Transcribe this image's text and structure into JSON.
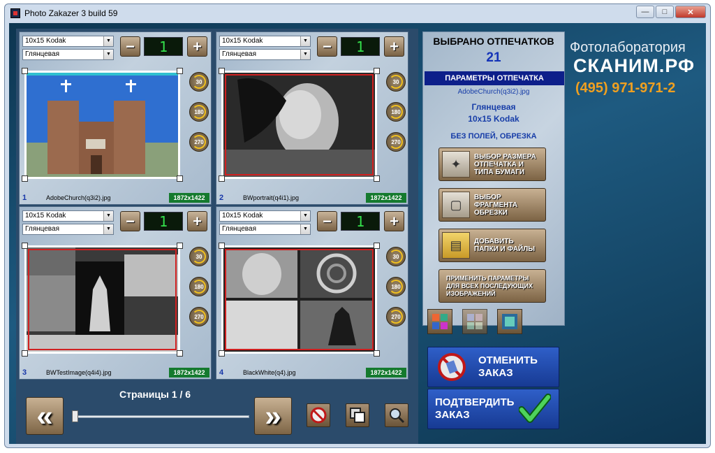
{
  "window": {
    "title": "Photo Zakazer 3 build 59",
    "controls": {
      "minimize": "—",
      "maximize": "□",
      "close": "✕"
    }
  },
  "cells": [
    {
      "index": "1",
      "size": "10x15 Kodak",
      "paper": "Глянцевая",
      "qty": "1",
      "file": "AdobeChurch(q3i2).jpg",
      "resolution": "1872x1422"
    },
    {
      "index": "2",
      "size": "10x15 Kodak",
      "paper": "Глянцевая",
      "qty": "1",
      "file": "BWportrait(q4i1).jpg",
      "resolution": "1872x1422"
    },
    {
      "index": "3",
      "size": "10x15 Kodak",
      "paper": "Глянцевая",
      "qty": "1",
      "file": "BWTestImage(q4i4).jpg",
      "resolution": "1872x1422"
    },
    {
      "index": "4",
      "size": "10x15 Kodak",
      "paper": "Глянцевая",
      "qty": "1",
      "file": "BlackWhite(q4).jpg",
      "resolution": "1872x1422"
    }
  ],
  "rotate": {
    "r30": "30",
    "r180": "180",
    "r270": "270"
  },
  "pager": {
    "label": "Страницы 1 / 6",
    "prev": "«",
    "next": "»"
  },
  "panel": {
    "selected_title": "ВЫБРАНО ОТПЕЧАТКОВ",
    "selected_count": "21",
    "params_title": "ПАРАМЕТРЫ ОТПЕЧАТКА",
    "file": "AdobeChurch(q3i2).jpg",
    "paper": "Глянцевая",
    "size": "10x15 Kodak",
    "mode": "БЕЗ ПОЛЕЙ, ОБРЕЗКА",
    "buttons": {
      "size": "ВЫБОР РАЗМЕРА\nОТПЕЧАТКА И\nТИПА БУМАГИ",
      "crop": "ВЫБОР\nФРАГМЕНТА\nОБРЕЗКИ",
      "add": "ДОБАВИТЬ\nПАПКИ И ФАЙЛЫ",
      "apply": "ПРИМЕНИТЬ ПАРАМЕТРЫ\nДЛЯ ВСЕХ ПОСЛЕДУЮЩИХ\nИЗОБРАЖЕНИЙ"
    }
  },
  "brand": {
    "line1": "Фотолаборатория",
    "line2": "СКАНИМ.РФ",
    "phone": "(495) 971-971-2"
  },
  "actions": {
    "cancel": "ОТМЕНИТЬ\nЗАКАЗ",
    "confirm": "ПОДТВЕРДИТЬ\nЗАКАЗ"
  },
  "colors": {
    "quantity_led": "#34e04b",
    "cancel_blue": "#2f5fc8",
    "brand_orange": "#f0a020",
    "resolution_badge": "#157a2e"
  }
}
